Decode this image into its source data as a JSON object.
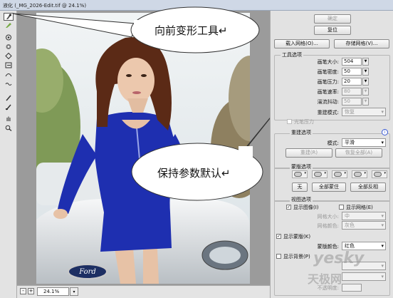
{
  "window": {
    "title": "液化 (_MG_2026-Edit.tif @ 24.1%)"
  },
  "toolbar": {
    "tools": [
      {
        "icon": "forward-warp-icon"
      },
      {
        "icon": "reconstruct-icon"
      },
      {
        "icon": "twirl-icon"
      },
      {
        "icon": "pucker-icon"
      },
      {
        "icon": "bloat-icon"
      },
      {
        "icon": "push-left-icon"
      },
      {
        "icon": "mirror-icon"
      },
      {
        "icon": "turbulence-icon"
      },
      {
        "icon": "freeze-mask-icon"
      },
      {
        "icon": "thaw-mask-icon"
      },
      {
        "icon": "hand-icon"
      },
      {
        "icon": "zoom-icon"
      }
    ]
  },
  "callouts": {
    "forward_warp": "向前变形工具↵",
    "keep_default": "保持参数默认↵"
  },
  "canvas": {
    "photo_badge": "Ford"
  },
  "statusbar": {
    "zoom_out": "-",
    "zoom_in": "+",
    "zoom": "24.1%",
    "zoom_dd": "▾"
  },
  "panel": {
    "ok": "确定",
    "reset": "复位",
    "load_mesh": "载入网格(O)...",
    "save_mesh": "存储网格(V)...",
    "tool_options": {
      "title": "工具选项",
      "brush_size": {
        "label": "画笔大小:",
        "value": "504"
      },
      "brush_density": {
        "label": "画笔密度:",
        "value": "50"
      },
      "brush_pressure": {
        "label": "画笔压力:",
        "value": "20"
      },
      "brush_rate": {
        "label": "画笔速率:",
        "value": "80"
      },
      "turbulent_jitter": {
        "label": "湍流抖动:",
        "value": "50"
      },
      "reconstruct_mode": {
        "label": "重建模式:",
        "value": "恢复"
      },
      "stylus_pressure": "光笔压力"
    },
    "reconstruct_options": {
      "title": "重建选项",
      "info": "i",
      "mode_label": "模式:",
      "mode_value": "平滑",
      "reconstruct_btn": "重建(R)",
      "restore_all_btn": "恢复全部(A)"
    },
    "mask_options": {
      "title": "蒙版选项",
      "none_btn": "无",
      "mask_all_btn": "全部蒙住",
      "invert_all_btn": "全部反相"
    },
    "view_options": {
      "title": "视图选项",
      "show_image": "显示图像(I)",
      "show_mesh": "显示网格(E)",
      "mesh_size_label": "网格大小:",
      "mesh_size_value": "中",
      "mesh_color_label": "网格颜色:",
      "mesh_color_value": "灰色",
      "show_mask": "显示蒙版(K)",
      "mask_color_label": "蒙版颜色:",
      "mask_color_value": "红色",
      "show_backdrop": "显示背景(P)",
      "opacity_label": "不透明度:"
    }
  },
  "watermark": {
    "latin": "yesky",
    "chinese": "天极网"
  },
  "colors": {
    "dress": "#1e2fb0",
    "hair": "#5b2a16",
    "panel_bg": "#e2e2e2",
    "callout_bg": "#ffffff"
  }
}
